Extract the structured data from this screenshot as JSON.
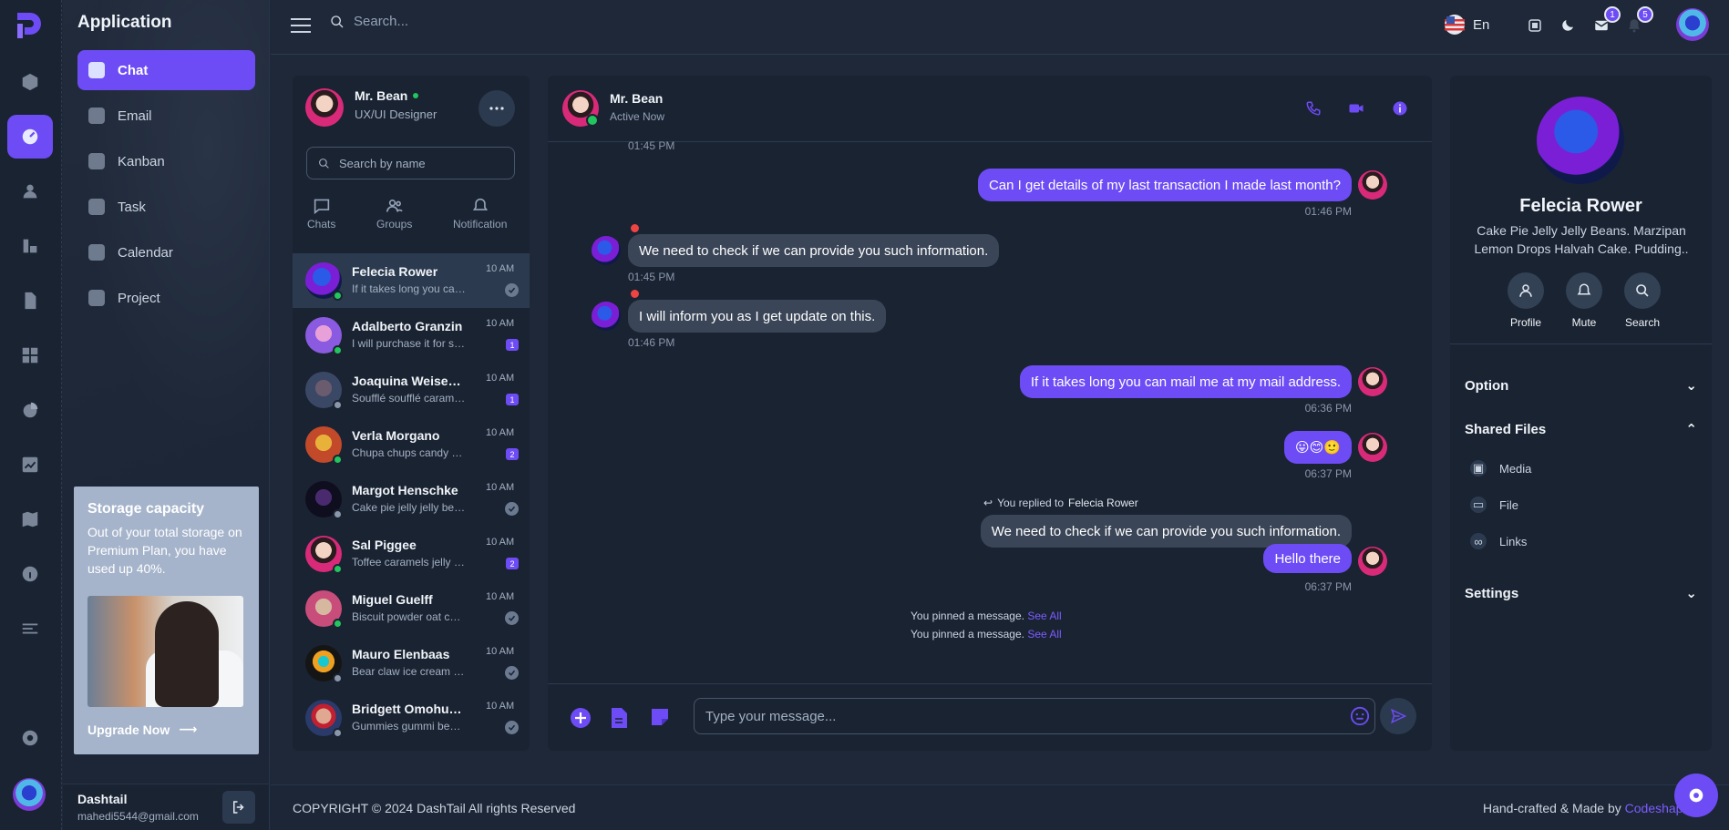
{
  "app": {
    "sidebar_title": "Application"
  },
  "sidebar": {
    "items": [
      {
        "label": "Chat",
        "icon": "chat-icon"
      },
      {
        "label": "Email",
        "icon": "email-icon"
      },
      {
        "label": "Kanban",
        "icon": "kanban-icon"
      },
      {
        "label": "Task",
        "icon": "task-icon"
      },
      {
        "label": "Calendar",
        "icon": "calendar-icon"
      },
      {
        "label": "Project",
        "icon": "project-icon"
      }
    ],
    "storage": {
      "title": "Storage capacity",
      "text": "Out of your total storage on Premium Plan, you have used up 40%.",
      "cta": "Upgrade Now"
    },
    "user": {
      "name": "Dashtail",
      "email": "mahedi5544@gmail.com"
    }
  },
  "topbar": {
    "search_placeholder": "Search...",
    "language": "En",
    "mail_count": "1",
    "notification_count": "5"
  },
  "contacts": {
    "me": {
      "name": "Mr. Bean",
      "role": "UX/UI Designer"
    },
    "search_placeholder": "Search by name",
    "tabs": [
      "Chats",
      "Groups",
      "Notification"
    ],
    "list": [
      {
        "name": "Felecia Rower",
        "message": "If it takes long you can mail me at my mail address.",
        "time": "10 AM",
        "status": "read",
        "online": true
      },
      {
        "name": "Adalberto Granzin",
        "message": "I will purchase it for sure.",
        "time": "10 AM",
        "status": "1",
        "online": true
      },
      {
        "name": "Joaquina Weisenborn",
        "message": "Soufflé soufflé caramels sweet roll.",
        "time": "10 AM",
        "status": "1",
        "online": false
      },
      {
        "name": "Verla Morgano",
        "message": "Chupa chups candy canes chocolate.",
        "time": "10 AM",
        "status": "2",
        "online": true
      },
      {
        "name": "Margot Henschke",
        "message": "Cake pie jelly jelly beans.",
        "time": "10 AM",
        "status": "read",
        "online": false
      },
      {
        "name": "Sal Piggee",
        "message": "Toffee caramels jelly beans.",
        "time": "10 AM",
        "status": "2",
        "online": true
      },
      {
        "name": "Miguel Guelff",
        "message": "Biscuit powder oat cake.",
        "time": "10 AM",
        "status": "read",
        "online": true
      },
      {
        "name": "Mauro Elenbaas",
        "message": "Bear claw ice cream lollipop.",
        "time": "10 AM",
        "status": "read",
        "online": false
      },
      {
        "name": "Bridgett Omohundro",
        "message": "Gummies gummi bears.",
        "time": "10 AM",
        "status": "read",
        "online": false
      }
    ]
  },
  "chat": {
    "header": {
      "name": "Mr. Bean",
      "status": "Active Now"
    },
    "top_time": "01:45 PM",
    "messages": [
      {
        "text": "Can I get details of my last transaction I made last month?",
        "time": "01:46 PM"
      },
      {
        "text": "We need to check if we can provide you such information.",
        "time": "01:45 PM"
      },
      {
        "text": "I will inform you as I get update on this.",
        "time": "01:46 PM"
      },
      {
        "text": "If it takes long you can mail me at my mail address.",
        "time": "06:36 PM"
      },
      {
        "text": "😛😊🙂",
        "time": "06:37 PM"
      },
      {
        "text": "We need to check if we can provide you such information.",
        "time": ""
      },
      {
        "text": "Hello there",
        "time": "06:37 PM"
      }
    ],
    "reply_prefix": "You replied to",
    "reply_name": "Felecia Rower",
    "pinned": [
      {
        "text": "You pinned a message.",
        "link": "See All"
      },
      {
        "text": "You pinned a message.",
        "link": "See All"
      }
    ],
    "input_placeholder": "Type your message..."
  },
  "profile": {
    "name": "Felecia Rower",
    "bio": "Cake Pie Jelly Jelly Beans. Marzipan Lemon Drops Halvah Cake. Pudding..",
    "actions": [
      "Profile",
      "Mute",
      "Search"
    ],
    "sections": {
      "option": "Option",
      "shared": "Shared Files",
      "settings": "Settings"
    },
    "shared_items": [
      "Media",
      "File",
      "Links"
    ]
  },
  "footer": {
    "copyright": "COPYRIGHT © 2024 DashTail All rights Reserved",
    "made_by": "Hand-crafted & Made by",
    "brand": "Codeshaper"
  },
  "colors": {
    "accent": "#6d4cf6",
    "bg": "#1e2838",
    "panel": "#1a2332"
  }
}
